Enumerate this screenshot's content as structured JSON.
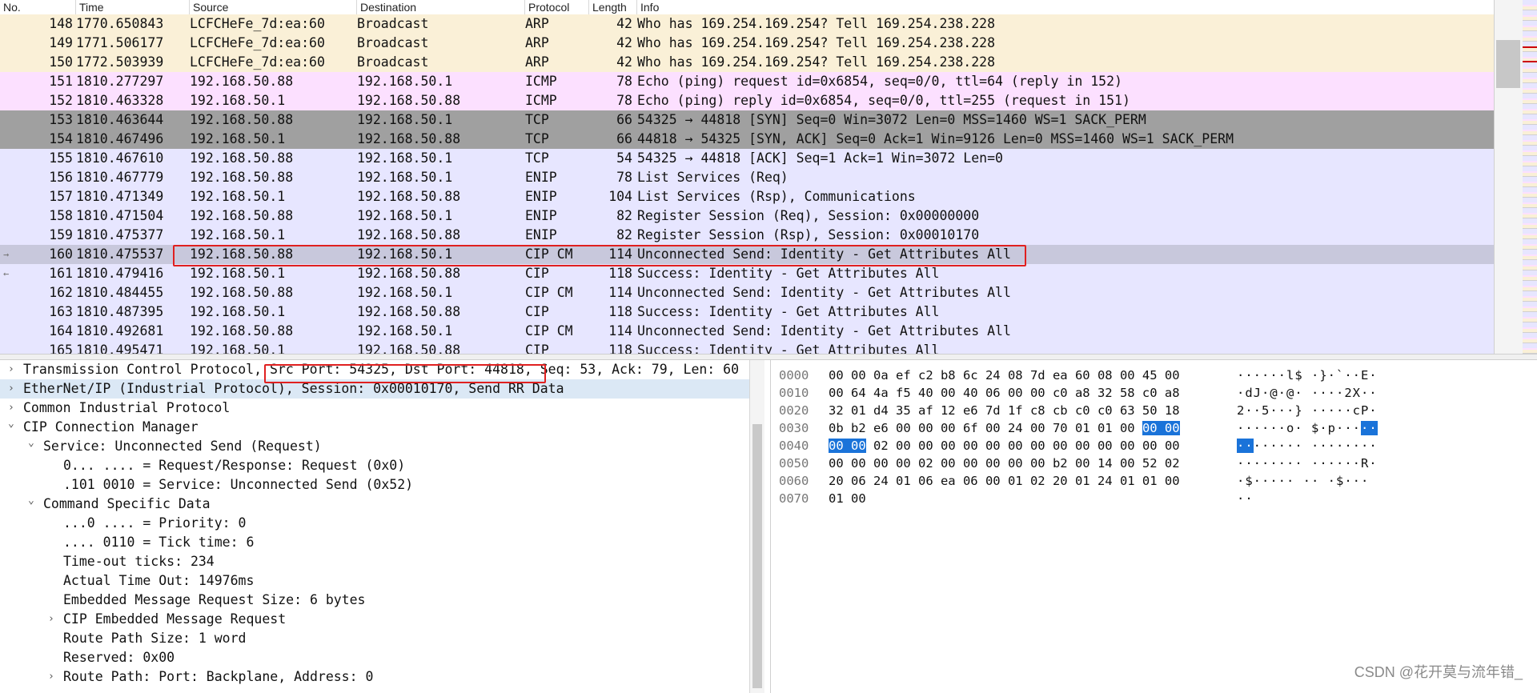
{
  "packet_list": {
    "columns": [
      "No.",
      "Time",
      "Source",
      "Destination",
      "Protocol",
      "Length",
      "Info"
    ],
    "rows": [
      {
        "no": "148",
        "time": "1770.650843",
        "src": "LCFCHeFe_7d:ea:60",
        "dst": "Broadcast",
        "proto": "ARP",
        "len": "42",
        "info": "Who has 169.254.169.254? Tell 169.254.238.228",
        "style": "arp"
      },
      {
        "no": "149",
        "time": "1771.506177",
        "src": "LCFCHeFe_7d:ea:60",
        "dst": "Broadcast",
        "proto": "ARP",
        "len": "42",
        "info": "Who has 169.254.169.254? Tell 169.254.238.228",
        "style": "arp"
      },
      {
        "no": "150",
        "time": "1772.503939",
        "src": "LCFCHeFe_7d:ea:60",
        "dst": "Broadcast",
        "proto": "ARP",
        "len": "42",
        "info": "Who has 169.254.169.254? Tell 169.254.238.228",
        "style": "arp"
      },
      {
        "no": "151",
        "time": "1810.277297",
        "src": "192.168.50.88",
        "dst": "192.168.50.1",
        "proto": "ICMP",
        "len": "78",
        "info": "Echo (ping) request  id=0x6854, seq=0/0, ttl=64 (reply in 152)",
        "style": "icmp"
      },
      {
        "no": "152",
        "time": "1810.463328",
        "src": "192.168.50.1",
        "dst": "192.168.50.88",
        "proto": "ICMP",
        "len": "78",
        "info": "Echo (ping) reply    id=0x6854, seq=0/0, ttl=255 (request in 151)",
        "style": "icmp"
      },
      {
        "no": "153",
        "time": "1810.463644",
        "src": "192.168.50.88",
        "dst": "192.168.50.1",
        "proto": "TCP",
        "len": "66",
        "info": "54325 → 44818 [SYN] Seq=0 Win=3072 Len=0 MSS=1460 WS=1 SACK_PERM",
        "style": "syn"
      },
      {
        "no": "154",
        "time": "1810.467496",
        "src": "192.168.50.1",
        "dst": "192.168.50.88",
        "proto": "TCP",
        "len": "66",
        "info": "44818 → 54325 [SYN, ACK] Seq=0 Ack=1 Win=9126 Len=0 MSS=1460 WS=1 SACK_PERM",
        "style": "syn"
      },
      {
        "no": "155",
        "time": "1810.467610",
        "src": "192.168.50.88",
        "dst": "192.168.50.1",
        "proto": "TCP",
        "len": "54",
        "info": "54325 → 44818 [ACK] Seq=1 Ack=1 Win=3072 Len=0",
        "style": "tcp"
      },
      {
        "no": "156",
        "time": "1810.467779",
        "src": "192.168.50.88",
        "dst": "192.168.50.1",
        "proto": "ENIP",
        "len": "78",
        "info": "List Services (Req)",
        "style": "tcp"
      },
      {
        "no": "157",
        "time": "1810.471349",
        "src": "192.168.50.1",
        "dst": "192.168.50.88",
        "proto": "ENIP",
        "len": "104",
        "info": "List Services (Rsp), Communications",
        "style": "tcp"
      },
      {
        "no": "158",
        "time": "1810.471504",
        "src": "192.168.50.88",
        "dst": "192.168.50.1",
        "proto": "ENIP",
        "len": "82",
        "info": "Register Session (Req), Session: 0x00000000",
        "style": "tcp"
      },
      {
        "no": "159",
        "time": "1810.475377",
        "src": "192.168.50.1",
        "dst": "192.168.50.88",
        "proto": "ENIP",
        "len": "82",
        "info": "Register Session (Rsp), Session: 0x00010170",
        "style": "tcp"
      },
      {
        "no": "160",
        "time": "1810.475537",
        "src": "192.168.50.88",
        "dst": "192.168.50.1",
        "proto": "CIP CM",
        "len": "114",
        "info": "Unconnected Send: Identity - Get Attributes All",
        "style": "sel"
      },
      {
        "no": "161",
        "time": "1810.479416",
        "src": "192.168.50.1",
        "dst": "192.168.50.88",
        "proto": "CIP",
        "len": "118",
        "info": "Success: Identity - Get Attributes All",
        "style": "tcp"
      },
      {
        "no": "162",
        "time": "1810.484455",
        "src": "192.168.50.88",
        "dst": "192.168.50.1",
        "proto": "CIP CM",
        "len": "114",
        "info": "Unconnected Send: Identity - Get Attributes All",
        "style": "tcp"
      },
      {
        "no": "163",
        "time": "1810.487395",
        "src": "192.168.50.1",
        "dst": "192.168.50.88",
        "proto": "CIP",
        "len": "118",
        "info": "Success: Identity - Get Attributes All",
        "style": "tcp"
      },
      {
        "no": "164",
        "time": "1810.492681",
        "src": "192.168.50.88",
        "dst": "192.168.50.1",
        "proto": "CIP CM",
        "len": "114",
        "info": "Unconnected Send: Identity - Get Attributes All",
        "style": "tcp"
      },
      {
        "no": "165",
        "time": "1810.495471",
        "src": "192.168.50.1",
        "dst": "192.168.50.88",
        "proto": "CIP",
        "len": "118",
        "info": "Success: Identity - Get Attributes All",
        "style": "tcp"
      }
    ]
  },
  "details": {
    "rows": [
      {
        "indent": 0,
        "arrow": ">",
        "text": "Transmission Control Protocol, Src Port: 54325, Dst Port: 44818, Seq: 53, Ack: 79, Len: 60"
      },
      {
        "indent": 0,
        "arrow": ">",
        "text": "EtherNet/IP (Industrial Protocol), Session: 0x00010170, Send RR Data",
        "highlight": true
      },
      {
        "indent": 0,
        "arrow": ">",
        "text": "Common Industrial Protocol"
      },
      {
        "indent": 0,
        "arrow": "v",
        "text": "CIP Connection Manager"
      },
      {
        "indent": 1,
        "arrow": "v",
        "text": "Service: Unconnected Send (Request)"
      },
      {
        "indent": 2,
        "arrow": "",
        "text": "0... .... = Request/Response: Request (0x0)"
      },
      {
        "indent": 2,
        "arrow": "",
        "text": ".101 0010 = Service: Unconnected Send (0x52)"
      },
      {
        "indent": 1,
        "arrow": "v",
        "text": "Command Specific Data"
      },
      {
        "indent": 2,
        "arrow": "",
        "text": "...0 .... = Priority: 0"
      },
      {
        "indent": 2,
        "arrow": "",
        "text": ".... 0110 = Tick time: 6"
      },
      {
        "indent": 2,
        "arrow": "",
        "text": "Time-out ticks: 234"
      },
      {
        "indent": 2,
        "arrow": "",
        "text": "Actual Time Out: 14976ms"
      },
      {
        "indent": 2,
        "arrow": "",
        "text": "Embedded Message Request Size: 6 bytes"
      },
      {
        "indent": 2,
        "arrow": ">",
        "text": "CIP Embedded Message Request"
      },
      {
        "indent": 2,
        "arrow": "",
        "text": "Route Path Size: 1 word"
      },
      {
        "indent": 2,
        "arrow": "",
        "text": "Reserved: 0x00"
      },
      {
        "indent": 2,
        "arrow": ">",
        "text": "Route Path: Port: Backplane, Address: 0"
      }
    ]
  },
  "hex": {
    "rows": [
      {
        "off": "0000",
        "bytes": "00 00 0a ef c2 b8 6c 24  08 7d ea 60 08 00 45 00",
        "ascii": "······l$ ·}·`··E·"
      },
      {
        "off": "0010",
        "bytes": "00 64 4a f5 40 00 40 06  00 00 c0 a8 32 58 c0 a8",
        "ascii": "·dJ·@·@· ····2X··"
      },
      {
        "off": "0020",
        "bytes": "32 01 d4 35 af 12 e6 7d  1f c8 cb c0 c0 63 50 18",
        "ascii": "2··5···} ·····cP·"
      },
      {
        "off": "0030",
        "bytes": "0b b2 e6 00 00 00 6f 00  24 00 70 01 01 00 ",
        "sel": "00 00",
        "ascii": "······o· $·p···",
        "asel": "··"
      },
      {
        "off": "0040",
        "pre_sel": "00 00",
        "bytes": " 02 00 00 00 00 00  00 00 00 00 00 00 00 00",
        "pre_asel": "··",
        "ascii": "······ ········"
      },
      {
        "off": "0050",
        "bytes": "00 00 00 00 02 00 00 00  00 00 b2 00 14 00 52 02",
        "ascii": "········ ······R·"
      },
      {
        "off": "0060",
        "bytes": "20 06 24 01 06 ea 06 00  01 02 20 01 24 01 01 00",
        "ascii": " ·$····· ·· ·$···"
      },
      {
        "off": "0070",
        "bytes": "01 00",
        "ascii": "··"
      }
    ]
  },
  "watermark": "CSDN @花开莫与流年错_",
  "colors": {
    "arp": "#faf0d7",
    "icmp": "#fce0ff",
    "syn": "#a0a0a0",
    "tcp": "#e7e6ff",
    "sel": "#c8c8dc",
    "annotation": "#e02020",
    "hex_select": "#1a73d9"
  }
}
